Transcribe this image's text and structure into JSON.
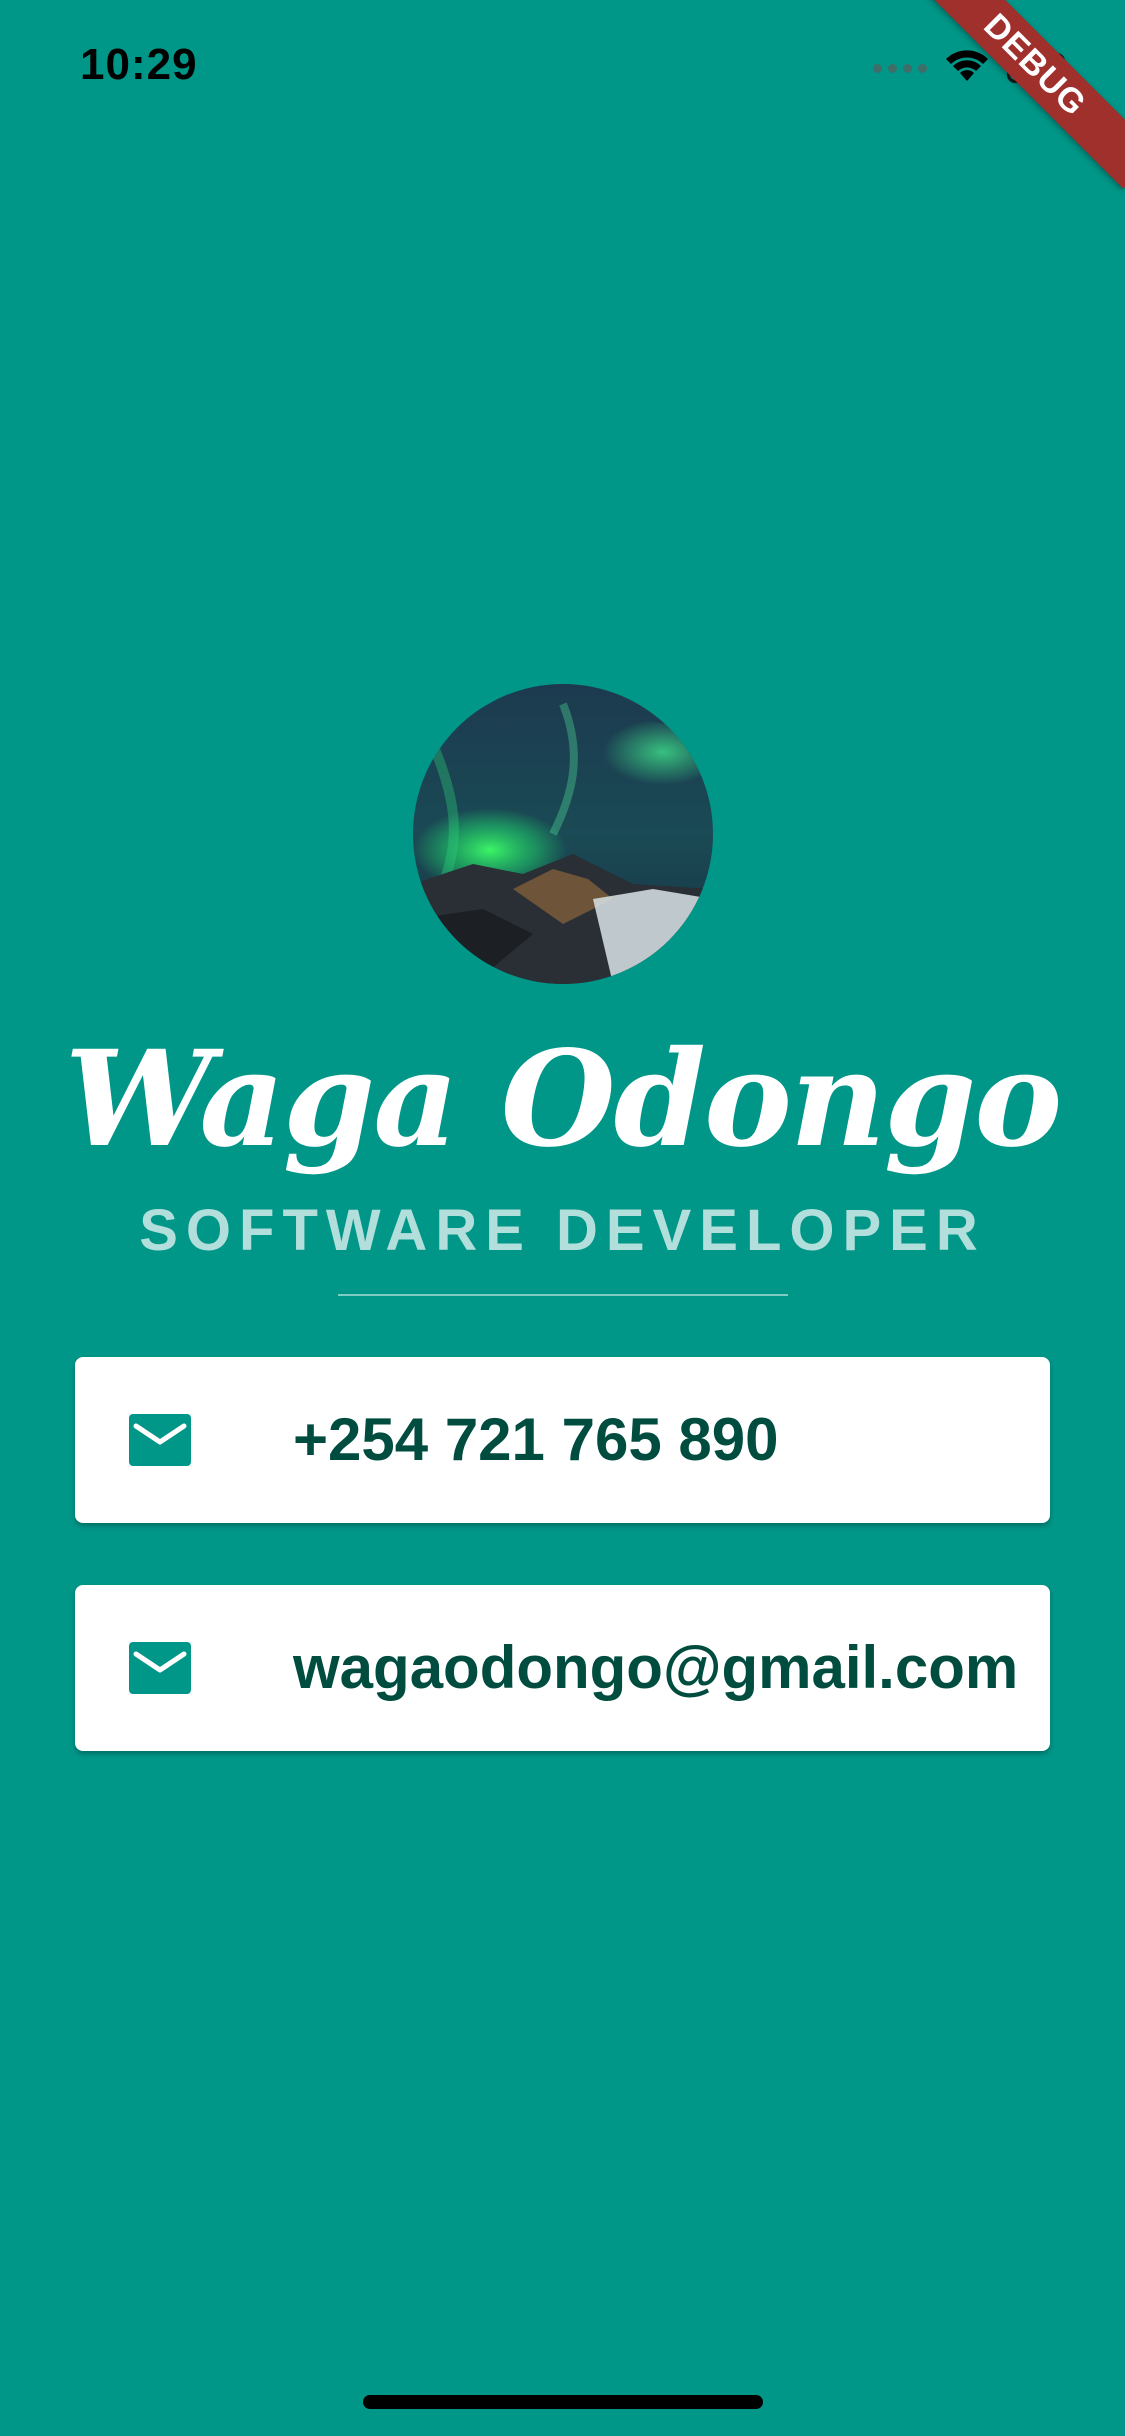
{
  "status_bar": {
    "time": "10:29",
    "wifi_icon": "wifi-icon",
    "battery_icon": "battery-icon"
  },
  "debug_banner": {
    "label": "DEBUG",
    "color": "#a0302c"
  },
  "profile": {
    "avatar_icon": "aurora-avatar-image",
    "name": "Waga Odongo",
    "title": "SOFTWARE DEVELOPER"
  },
  "contacts": [
    {
      "icon": "mail-icon",
      "value": "+254 721 765 890"
    },
    {
      "icon": "mail-icon",
      "value": "wagaodongo@gmail.com"
    }
  ],
  "colors": {
    "background": "#009688",
    "card_text": "#004d40",
    "subtitle": "#b2dfdb",
    "card_background": "#ffffff"
  }
}
